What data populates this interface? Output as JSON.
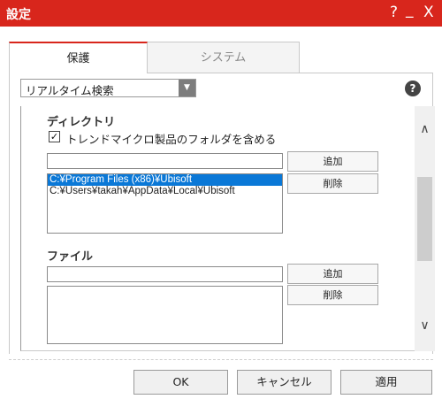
{
  "titlebar": {
    "title": "設定",
    "help_label": "?",
    "minimize_label": "_",
    "close_label": "X"
  },
  "tabs": [
    {
      "label": "保護",
      "active": true
    },
    {
      "label": "システム",
      "active": false
    }
  ],
  "dropdown": {
    "selected": "リアルタイム検索"
  },
  "help_icon_label": "?",
  "directory_section": {
    "title": "ディレクトリ",
    "checkbox_label": "トレンドマイクロ製品のフォルダを含める",
    "checkbox_checked": true,
    "input_value": "",
    "add_label": "追加",
    "delete_label": "削除",
    "items": [
      {
        "path": "C:¥Program Files (x86)¥Ubisoft",
        "selected": true
      },
      {
        "path": "C:¥Users¥takah¥AppData¥Local¥Ubisoft",
        "selected": false
      }
    ]
  },
  "file_section": {
    "title": "ファイル",
    "input_value": "",
    "add_label": "追加",
    "delete_label": "削除",
    "items": []
  },
  "footer": {
    "ok_label": "OK",
    "cancel_label": "キャンセル",
    "apply_label": "適用"
  },
  "colors": {
    "titlebar": "#d8261c",
    "selection": "#0a78d7"
  }
}
